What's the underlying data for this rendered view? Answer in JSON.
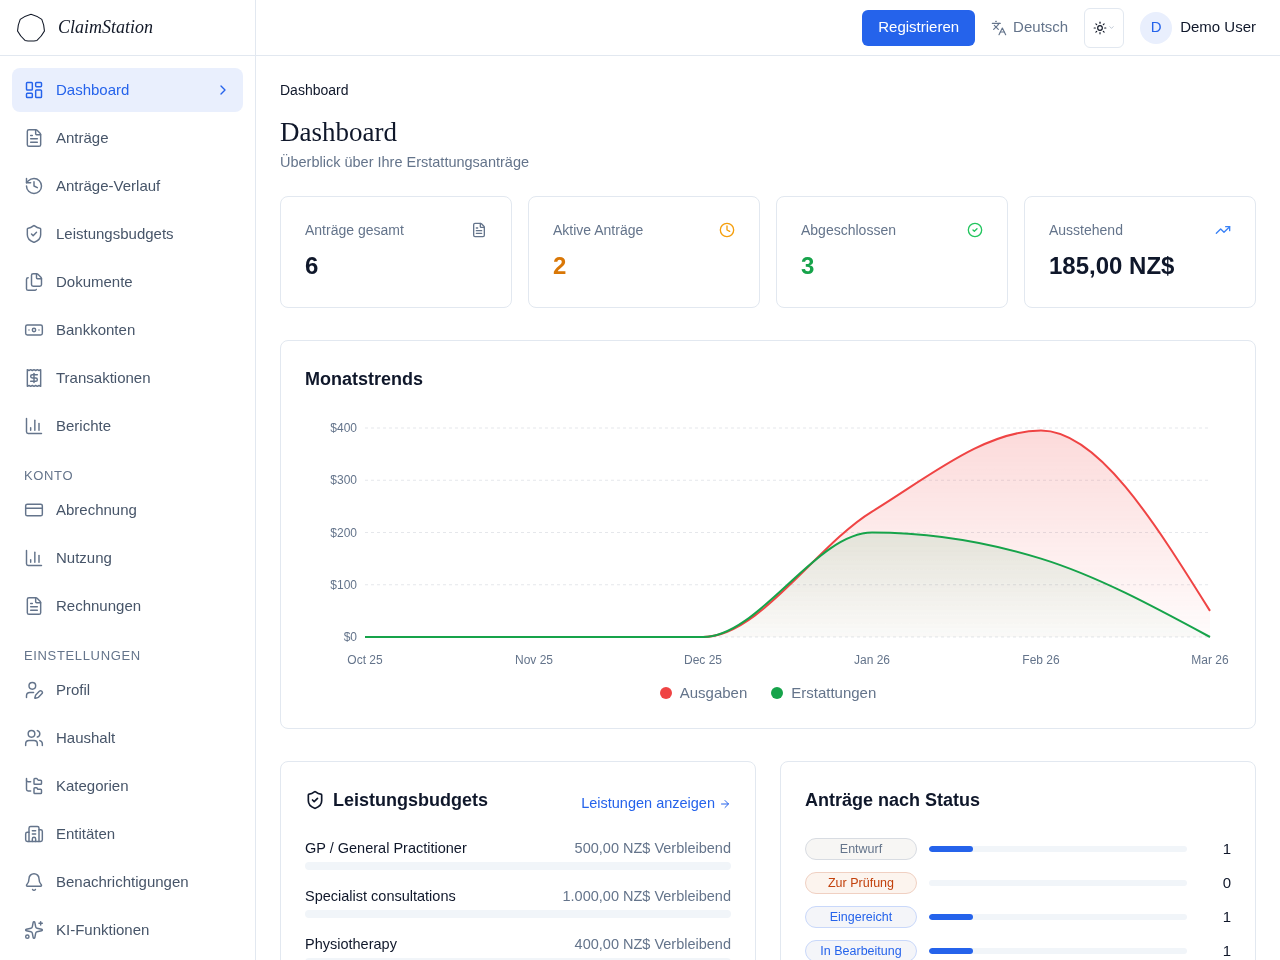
{
  "sidebar": {
    "logo": "ClaimStation",
    "sections": [
      {
        "items": [
          {
            "label": "Dashboard",
            "selected": true
          },
          {
            "label": "Anträge",
            "selected": false
          },
          {
            "label": "Anträge-Verlauf",
            "selected": false
          },
          {
            "label": "Leistungsbudgets",
            "selected": false
          },
          {
            "label": "Dokumente",
            "selected": false
          },
          {
            "label": "Bankkonten",
            "selected": false
          },
          {
            "label": "Transaktionen",
            "selected": false
          },
          {
            "label": "Berichte",
            "selected": false
          }
        ]
      },
      {
        "heading": "KONTO",
        "items": [
          {
            "label": "Abrechnung",
            "selected": false
          },
          {
            "label": "Nutzung",
            "selected": false
          },
          {
            "label": "Rechnungen",
            "selected": false
          }
        ]
      },
      {
        "heading": "EINSTELLUNGEN",
        "items": [
          {
            "label": "Profil",
            "selected": false
          },
          {
            "label": "Haushalt",
            "selected": false
          },
          {
            "label": "Kategorien",
            "selected": false
          },
          {
            "label": "Entitäten",
            "selected": false
          },
          {
            "label": "Benachrichtigungen",
            "selected": false
          },
          {
            "label": "KI-Funktionen",
            "selected": false
          }
        ]
      }
    ]
  },
  "header": {
    "register_button": "Registrieren",
    "language": "Deutsch",
    "user": {
      "initial": "D",
      "name": "Demo User"
    }
  },
  "breadcrumb": "Dashboard",
  "page": {
    "title": "Dashboard",
    "subtitle": "Überblick über Ihre Erstattungsanträge"
  },
  "stats": [
    {
      "kind": "total",
      "label": "Anträge gesamt",
      "value": "6"
    },
    {
      "kind": "active",
      "label": "Aktive Anträge",
      "value": "2"
    },
    {
      "kind": "completed",
      "label": "Abgeschlossen",
      "value": "3"
    },
    {
      "kind": "pending",
      "label": "Ausstehend",
      "value": "185,00 NZ$"
    }
  ],
  "monthly_trends": {
    "title": "Monatstrends",
    "chart_data": {
      "type": "area",
      "categories": [
        "Oct 25",
        "Nov 25",
        "Dec 25",
        "Jan 26",
        "Feb 26",
        "Mar 26"
      ],
      "series": [
        {
          "name": "Ausgaben",
          "color": "#ef4444",
          "values": [
            0,
            0,
            0,
            240,
            395,
            50
          ]
        },
        {
          "name": "Erstattungen",
          "color": "#16a34a",
          "values": [
            0,
            0,
            0,
            200,
            150,
            0
          ]
        }
      ],
      "ylim": [
        0,
        400
      ],
      "yticks": [
        {
          "value": 0,
          "label": "$0"
        },
        {
          "value": 100,
          "label": "$100"
        },
        {
          "value": 200,
          "label": "$200"
        },
        {
          "value": 300,
          "label": "$300"
        },
        {
          "value": 400,
          "label": "$400"
        }
      ],
      "grid": true,
      "legend": "bottom"
    }
  },
  "benefit_budgets": {
    "title": "Leistungsbudgets",
    "link": "Leistungen anzeigen",
    "items": [
      {
        "name": "GP / General Practitioner",
        "remaining": "500,00 NZ$ Verbleibend",
        "level": 0
      },
      {
        "name": "Specialist consultations",
        "remaining": "1.000,00 NZ$ Verbleibend",
        "level": 0
      },
      {
        "name": "Physiotherapy",
        "remaining": "400,00 NZ$ Verbleibend",
        "level": 0
      }
    ]
  },
  "claims_by_status": {
    "title": "Anträge nach Status",
    "items": [
      {
        "label": "Entwurf",
        "color": "#64748b",
        "level": 0.17,
        "count": "1"
      },
      {
        "label": "Zur Prüfung",
        "color": "#c2410c",
        "level": 0,
        "count": "0"
      },
      {
        "label": "Eingereicht",
        "color": "#2563eb",
        "level": 0.17,
        "count": "1"
      },
      {
        "label": "In Bearbeitung",
        "color": "#2563eb",
        "level": 0.17,
        "count": "1"
      }
    ]
  }
}
